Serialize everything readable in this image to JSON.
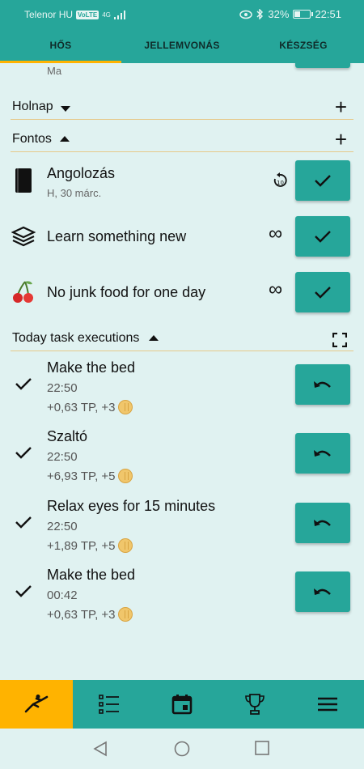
{
  "status": {
    "carrier": "Telenor HU",
    "volte": "VoLTE",
    "network": "4G",
    "battery": "32%",
    "battery_level": 0.32,
    "time": "22:51"
  },
  "tabs": [
    {
      "label": "HŐS",
      "active": true
    },
    {
      "label": "JELLEMVONÁS",
      "active": false
    },
    {
      "label": "KÉSZSÉG",
      "active": false
    }
  ],
  "partial": {
    "subtitle": "Ma"
  },
  "sections": {
    "holnap": {
      "label": "Holnap",
      "expanded": false
    },
    "fontos": {
      "label": "Fontos",
      "expanded": true
    },
    "executions": {
      "label": "Today task executions",
      "expanded": true
    }
  },
  "tasks": [
    {
      "title": "Angolozás",
      "date": "H, 30 márc.",
      "icon": "book-icon",
      "repeat": "10",
      "repeat_icon": "replay-10-icon"
    },
    {
      "title": "Learn something new",
      "date": "",
      "icon": "books-stack-icon",
      "repeat": "∞",
      "repeat_icon": "infinity-icon"
    },
    {
      "title": "No junk food for one day",
      "date": "",
      "icon": "cherries-icon",
      "repeat": "∞",
      "repeat_icon": "infinity-icon"
    }
  ],
  "executions": [
    {
      "title": "Make the bed",
      "time": "22:50",
      "reward": "+0,63 TP, +3"
    },
    {
      "title": "Szaltó",
      "time": "22:50",
      "reward": "+6,93 TP, +5"
    },
    {
      "title": "Relax eyes for 15 minutes",
      "time": "22:50",
      "reward": "+1,89 TP, +5"
    },
    {
      "title": "Make the bed",
      "time": "00:42",
      "reward": "+0,63 TP, +3"
    }
  ],
  "bottom_nav": [
    {
      "icon": "hero-icon",
      "active": true
    },
    {
      "icon": "checklist-icon",
      "active": false
    },
    {
      "icon": "calendar-icon",
      "active": false
    },
    {
      "icon": "trophy-icon",
      "active": false
    },
    {
      "icon": "menu-icon",
      "active": false
    }
  ],
  "colors": {
    "primary": "#26a69a",
    "accent": "#ffb300",
    "background": "#e0f2f1",
    "divider": "#e6c98a"
  }
}
